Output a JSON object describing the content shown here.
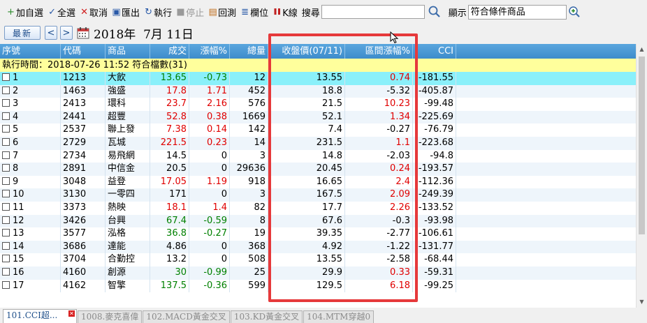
{
  "toolbar": {
    "items": [
      {
        "icon": "plus-icon",
        "glyph": "+",
        "color": "#2a8a2a",
        "label": "加自選",
        "disabled": false
      },
      {
        "icon": "check-icon",
        "glyph": "✓",
        "color": "#2a5aa8",
        "label": "全選",
        "disabled": false
      },
      {
        "icon": "cross-icon",
        "glyph": "✕",
        "color": "#d02020",
        "label": "取消",
        "disabled": false
      },
      {
        "icon": "export-icon",
        "glyph": "▣",
        "color": "#2a5aa8",
        "label": "匯出",
        "disabled": false
      },
      {
        "icon": "run-icon",
        "glyph": "↻",
        "color": "#2a5aa8",
        "label": "執行",
        "disabled": false
      },
      {
        "icon": "stop-icon",
        "glyph": "■",
        "color": "#9a9a9a",
        "label": "停止",
        "disabled": true
      },
      {
        "icon": "backtest-icon",
        "glyph": "▤",
        "color": "#c07020",
        "label": "回測",
        "disabled": false
      },
      {
        "icon": "columns-icon",
        "glyph": "≣",
        "color": "#2a5aa8",
        "label": "欄位",
        "disabled": false
      },
      {
        "icon": "kline-icon",
        "glyph": "❚❚",
        "color": "#c02020",
        "label": "K線",
        "disabled": false
      }
    ],
    "search_label": "搜尋",
    "search_value": "",
    "display_label": "顯示",
    "display_value": "符合條件商品"
  },
  "datebar": {
    "latest_label": "最新",
    "prev_label": "<",
    "next_label": ">",
    "date_text": "2018年  7月 11日"
  },
  "columns": [
    {
      "label": "序號",
      "w": 87,
      "align": "left"
    },
    {
      "label": "代碼",
      "w": 64,
      "align": "left"
    },
    {
      "label": "商品",
      "w": 64,
      "align": "left"
    },
    {
      "label": "成交",
      "w": 56,
      "align": "right"
    },
    {
      "label": "漲幅%",
      "w": 58,
      "align": "right"
    },
    {
      "label": "總量",
      "w": 55,
      "align": "right"
    },
    {
      "label": "收盤價(07/11)",
      "w": 110,
      "align": "right"
    },
    {
      "label": "區間漲幅%",
      "w": 97,
      "align": "right"
    },
    {
      "label": "CCI",
      "w": 62,
      "align": "right"
    }
  ],
  "info_row": "執行時間：2018-07-26 11:52 符合檔數(31)",
  "rows": [
    {
      "no": "1",
      "code": "1213",
      "name": "大飲",
      "price": "13.65",
      "chg": "-0.73",
      "vol": "12",
      "close": "13.55",
      "range": "0.74",
      "cci": "-181.55",
      "pc": "down",
      "rc": "up"
    },
    {
      "no": "2",
      "code": "1463",
      "name": "強盛",
      "price": "17.8",
      "chg": "1.71",
      "vol": "452",
      "close": "18.8",
      "range": "-5.32",
      "cci": "-405.87",
      "pc": "up",
      "rc": "flat"
    },
    {
      "no": "3",
      "code": "2413",
      "name": "環科",
      "price": "23.7",
      "chg": "2.16",
      "vol": "576",
      "close": "21.5",
      "range": "10.23",
      "cci": "-99.48",
      "pc": "up",
      "rc": "up"
    },
    {
      "no": "4",
      "code": "2441",
      "name": "超豐",
      "price": "52.8",
      "chg": "0.38",
      "vol": "1669",
      "close": "52.1",
      "range": "1.34",
      "cci": "-225.69",
      "pc": "up",
      "rc": "up"
    },
    {
      "no": "5",
      "code": "2537",
      "name": "聯上發",
      "price": "7.38",
      "chg": "0.14",
      "vol": "142",
      "close": "7.4",
      "range": "-0.27",
      "cci": "-76.79",
      "pc": "up",
      "rc": "flat"
    },
    {
      "no": "6",
      "code": "2729",
      "name": "瓦城",
      "price": "221.5",
      "chg": "0.23",
      "vol": "14",
      "close": "231.5",
      "range": "1.1",
      "cci": "-223.68",
      "pc": "up",
      "rc": "up"
    },
    {
      "no": "7",
      "code": "2734",
      "name": "易飛網",
      "price": "14.5",
      "chg": "0",
      "vol": "3",
      "close": "14.8",
      "range": "-2.03",
      "cci": "-94.8",
      "pc": "flat",
      "rc": "flat"
    },
    {
      "no": "8",
      "code": "2891",
      "name": "中信金",
      "price": "20.5",
      "chg": "0",
      "vol": "29636",
      "close": "20.45",
      "range": "0.24",
      "cci": "-193.57",
      "pc": "flat",
      "rc": "up"
    },
    {
      "no": "9",
      "code": "3048",
      "name": "益登",
      "price": "17.05",
      "chg": "1.19",
      "vol": "918",
      "close": "16.65",
      "range": "2.4",
      "cci": "-112.36",
      "pc": "up",
      "rc": "up"
    },
    {
      "no": "10",
      "code": "3130",
      "name": "一零四",
      "price": "171",
      "chg": "0",
      "vol": "3",
      "close": "167.5",
      "range": "2.09",
      "cci": "-249.39",
      "pc": "flat",
      "rc": "up"
    },
    {
      "no": "11",
      "code": "3373",
      "name": "熱映",
      "price": "18.1",
      "chg": "1.4",
      "vol": "82",
      "close": "17.7",
      "range": "2.26",
      "cci": "-133.52",
      "pc": "up",
      "rc": "up"
    },
    {
      "no": "12",
      "code": "3426",
      "name": "台興",
      "price": "67.4",
      "chg": "-0.59",
      "vol": "8",
      "close": "67.6",
      "range": "-0.3",
      "cci": "-93.98",
      "pc": "down",
      "rc": "flat"
    },
    {
      "no": "13",
      "code": "3577",
      "name": "泓格",
      "price": "36.8",
      "chg": "-0.27",
      "vol": "19",
      "close": "39.35",
      "range": "-2.77",
      "cci": "-106.61",
      "pc": "down",
      "rc": "flat"
    },
    {
      "no": "14",
      "code": "3686",
      "name": "達能",
      "price": "4.86",
      "chg": "0",
      "vol": "368",
      "close": "4.92",
      "range": "-1.22",
      "cci": "-131.77",
      "pc": "flat",
      "rc": "flat"
    },
    {
      "no": "15",
      "code": "3704",
      "name": "合勤控",
      "price": "13.2",
      "chg": "0",
      "vol": "508",
      "close": "13.55",
      "range": "-2.58",
      "cci": "-68.44",
      "pc": "flat",
      "rc": "flat"
    },
    {
      "no": "16",
      "code": "4160",
      "name": "創源",
      "price": "30",
      "chg": "-0.99",
      "vol": "25",
      "close": "29.9",
      "range": "0.33",
      "cci": "-59.31",
      "pc": "down",
      "rc": "up"
    },
    {
      "no": "17",
      "code": "4162",
      "name": "智擎",
      "price": "137.5",
      "chg": "-0.36",
      "vol": "599",
      "close": "129.5",
      "range": "6.18",
      "cci": "-99.25",
      "pc": "down",
      "rc": "up"
    }
  ],
  "tabs": [
    {
      "label": "101.CCI超...",
      "active": true
    },
    {
      "label": "1008.麥克喜偉",
      "active": false
    },
    {
      "label": "102.MACD黃金交叉",
      "active": false
    },
    {
      "label": "103.KD黃金交叉",
      "active": false
    },
    {
      "label": "104.MTM穿越0",
      "active": false
    }
  ],
  "colors": {
    "up": "#e00000",
    "down": "#008000",
    "header": "#4a9ad6",
    "selected_row": "#8af0fa",
    "info_row": "#ffff9c",
    "highlight": "#e6393b"
  }
}
